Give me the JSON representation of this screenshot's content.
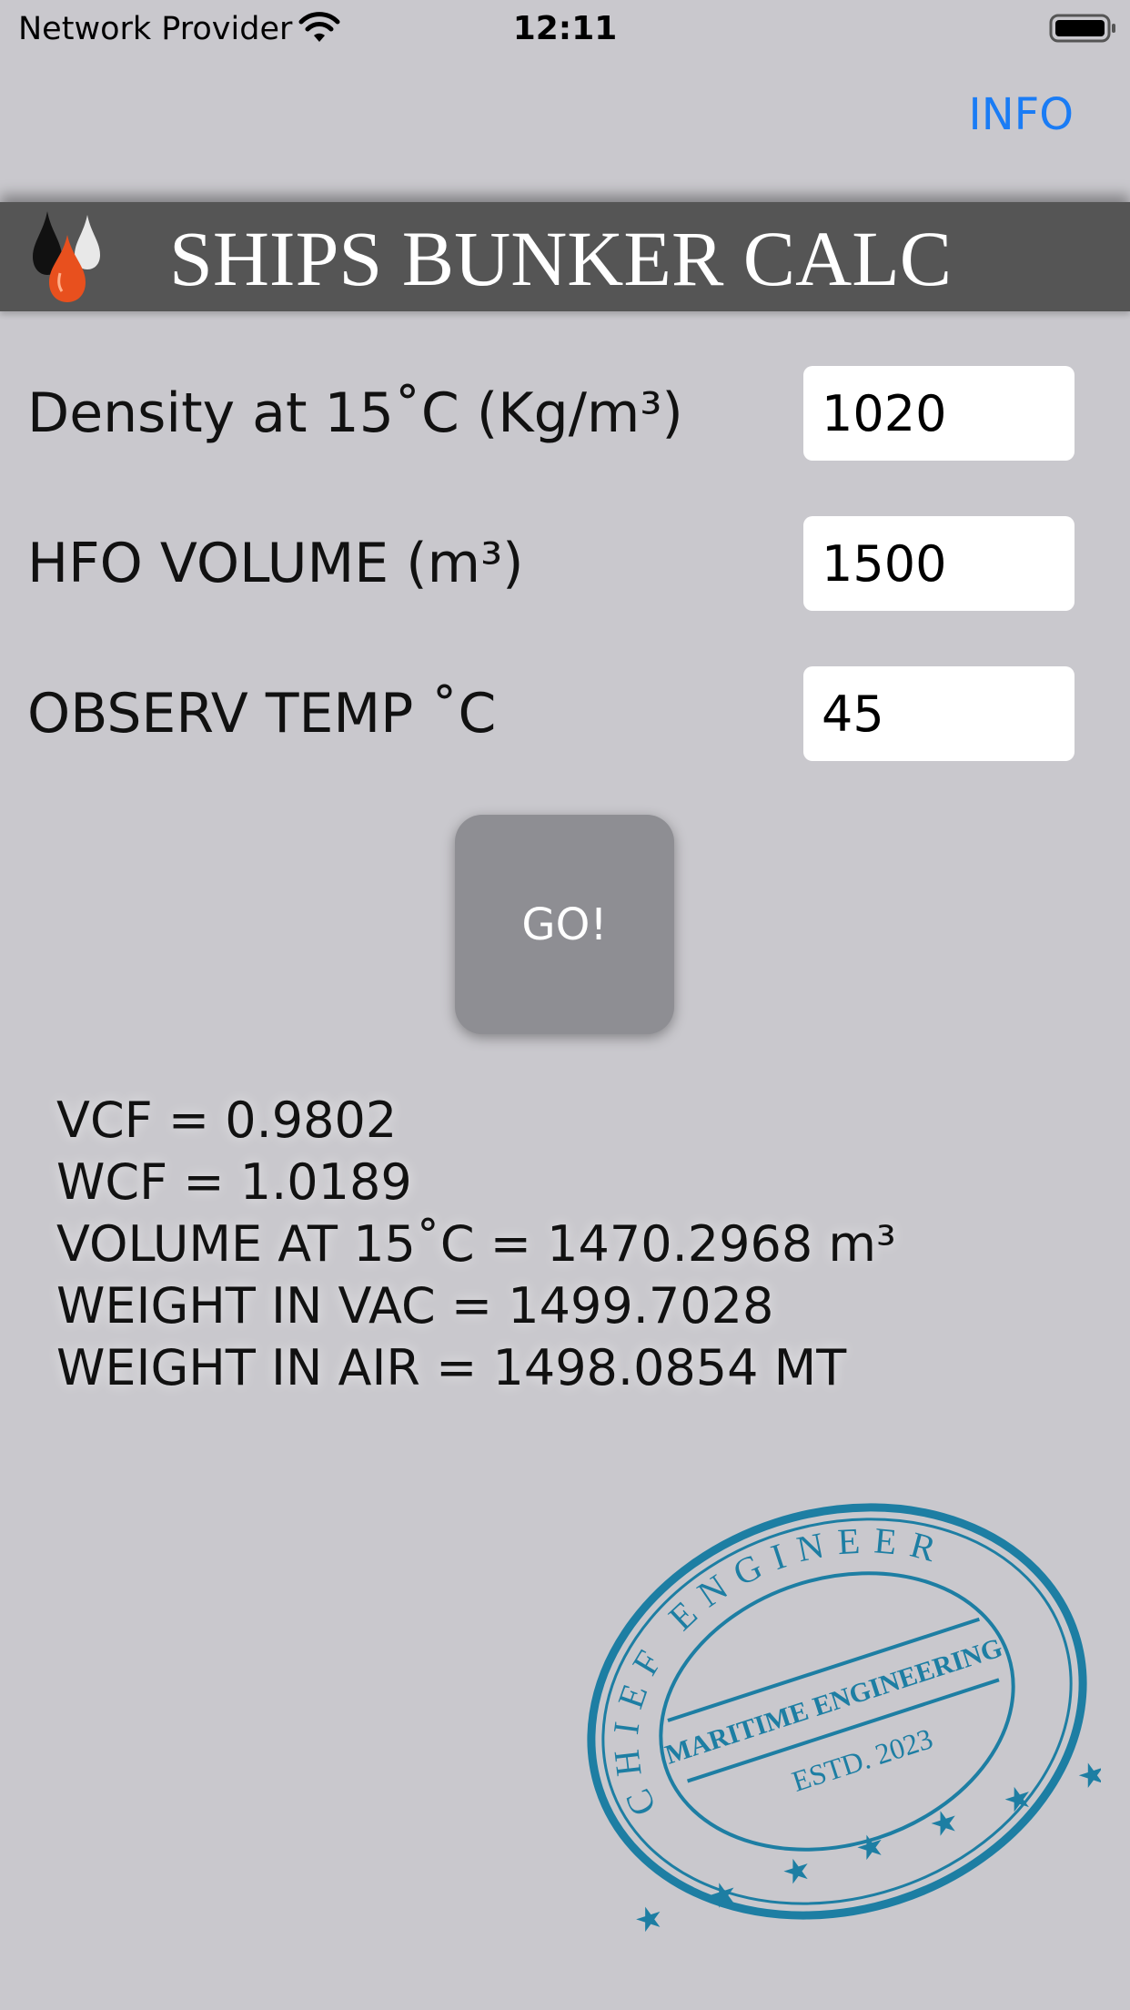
{
  "status_bar": {
    "carrier": "Network Provider",
    "time": "12:11"
  },
  "nav": {
    "info_label": "INFO"
  },
  "header": {
    "title": "SHIPS BUNKER CALC"
  },
  "form": {
    "density": {
      "label": "Density at 15˚C (Kg/m³)",
      "value": "1020"
    },
    "volume": {
      "label": "HFO VOLUME (m³)",
      "value": "1500"
    },
    "temp": {
      "label": "OBSERV TEMP ˚C",
      "value": "45"
    }
  },
  "go_button_label": "GO!",
  "results": [
    "VCF = 0.9802",
    "WCF = 1.0189",
    "VOLUME AT 15˚C = 1470.2968 m³",
    "WEIGHT IN VAC = 1499.7028",
    "WEIGHT IN AIR = 1498.0854 MT"
  ],
  "stamp": {
    "top_text": "CHIEF ENGINEER",
    "band_text": "MARITIME ENGINEERING",
    "est_text": "ESTD. 2023"
  },
  "colors": {
    "background": "#c9c8cd",
    "banner": "#555555",
    "link": "#1a7cf5",
    "button": "#8e8e93",
    "stamp": "#1d7ea3"
  }
}
